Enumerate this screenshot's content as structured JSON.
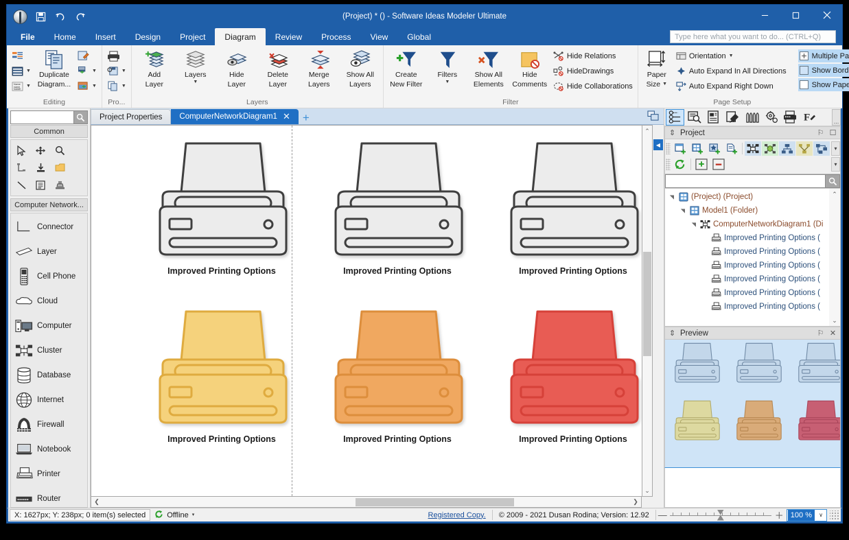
{
  "window": {
    "title": "(Project) * () - Software Ideas Modeler Ultimate",
    "minimize": "—",
    "maximize": "☐",
    "close": "✕"
  },
  "quick_access": {
    "save": "save-icon",
    "undo": "undo-icon",
    "redo": "redo-icon"
  },
  "tell_me": {
    "placeholder": "Type here what you want to do... (CTRL+Q)",
    "value": ""
  },
  "ribbon_tabs": [
    {
      "label": "File",
      "active": false,
      "bold": true
    },
    {
      "label": "Home",
      "active": false
    },
    {
      "label": "Insert",
      "active": false
    },
    {
      "label": "Design",
      "active": false
    },
    {
      "label": "Project",
      "active": false
    },
    {
      "label": "Diagram",
      "active": true
    },
    {
      "label": "Review",
      "active": false
    },
    {
      "label": "Process",
      "active": false
    },
    {
      "label": "View",
      "active": false
    },
    {
      "label": "Global",
      "active": false
    }
  ],
  "ribbon_groups": [
    {
      "label": "Editing",
      "small_left": [
        "rename-diagram",
        "diagram-style",
        "diagram-name"
      ],
      "big": [
        {
          "line1": "Duplicate",
          "line2": "Diagram..."
        }
      ],
      "small_right": [
        "edit-diagram",
        "add-element",
        "diagram-image"
      ]
    },
    {
      "label": "Pro...",
      "small": [
        "print",
        "save-as",
        "copy-diagram"
      ]
    },
    {
      "label": "Layers",
      "buttons": [
        {
          "line1": "Add",
          "line2": "Layer"
        },
        {
          "line1": "Layers",
          "line2": ""
        },
        {
          "line1": "Hide",
          "line2": "Layer"
        },
        {
          "line1": "Delete",
          "line2": "Layer"
        },
        {
          "line1": "Merge",
          "line2": "Layers"
        },
        {
          "line1": "Show All",
          "line2": "Layers"
        }
      ]
    },
    {
      "label": "Filter",
      "buttons": [
        {
          "line1": "Create",
          "line2": "New Filter"
        },
        {
          "line1": "Filters",
          "line2": ""
        },
        {
          "line1": "Show All",
          "line2": "Elements"
        },
        {
          "line1": "Hide",
          "line2": "Comments"
        }
      ],
      "small": [
        "Hide Relations",
        "HideDrawings",
        "Hide Collaborations"
      ]
    },
    {
      "label": "Page Setup",
      "paper": {
        "line1": "Paper",
        "line2": "Size"
      },
      "small": [
        "Orientation",
        "Auto Expand In All Directions",
        "Auto Expand Right Down"
      ],
      "checks": [
        "Multiple Pages",
        "Show Borders",
        "Show Paper"
      ]
    }
  ],
  "toolbox": {
    "search_placeholder": "",
    "search_value": "",
    "common_header": "Common",
    "common_tools": [
      "pointer-icon",
      "move-icon",
      "zoom-icon",
      "connector-tool-icon",
      "insert-icon",
      "note-icon",
      "line-icon",
      "text-icon",
      "stamp-icon"
    ],
    "category_header": "Computer Network...",
    "items": [
      {
        "label": "Connector",
        "icon": "connector-icon"
      },
      {
        "label": "Layer",
        "icon": "layer-icon"
      },
      {
        "label": "Cell Phone",
        "icon": "cell-phone-icon"
      },
      {
        "label": "Cloud",
        "icon": "cloud-icon"
      },
      {
        "label": "Computer",
        "icon": "computer-icon"
      },
      {
        "label": "Cluster",
        "icon": "cluster-icon"
      },
      {
        "label": "Database",
        "icon": "database-icon"
      },
      {
        "label": "Internet",
        "icon": "internet-icon"
      },
      {
        "label": "Firewall",
        "icon": "firewall-icon"
      },
      {
        "label": "Notebook",
        "icon": "notebook-icon"
      },
      {
        "label": "Printer",
        "icon": "printer-icon"
      },
      {
        "label": "Router",
        "icon": "router-icon"
      }
    ]
  },
  "doc_tabs": [
    {
      "label": "Project Properties",
      "active": false,
      "closable": false
    },
    {
      "label": "ComputerNetworkDiagram1",
      "active": true,
      "closable": true
    }
  ],
  "add_tab": "+",
  "canvas": {
    "shapes": [
      {
        "label": "Improved Printing Options",
        "fill": "#ececec",
        "stroke": "#3f3f3f",
        "col": 0,
        "row": 0
      },
      {
        "label": "Improved Printing Options",
        "fill": "#ececec",
        "stroke": "#3f3f3f",
        "col": 1,
        "row": 0
      },
      {
        "label": "Improved Printing Options",
        "fill": "#ececec",
        "stroke": "#3f3f3f",
        "col": 2,
        "row": 0
      },
      {
        "label": "Improved Printing Options",
        "fill": "#f5d27c",
        "stroke": "#dfab3f",
        "col": 0,
        "row": 1
      },
      {
        "label": "Improved Printing Options",
        "fill": "#f0a860",
        "stroke": "#dd8e3c",
        "col": 1,
        "row": 1
      },
      {
        "label": "Improved Printing Options",
        "fill": "#e85c54",
        "stroke": "#d64139",
        "col": 2,
        "row": 1
      }
    ]
  },
  "right_dock": {
    "icons": [
      "project-tree-icon",
      "find-icon",
      "documentation-icon",
      "styles-icon",
      "palette-icon",
      "settings-icon",
      "output-icon",
      "format-icon"
    ],
    "more": "...",
    "project_panel": {
      "title": "Project",
      "pin": "⚐",
      "float": "☐",
      "toolbar_row1": [
        "new-diagram-icon",
        "new-model-icon",
        "new-element-icon",
        "new-document-icon",
        "diagram-type-icon",
        "cluster-type-icon",
        "hierarchy-icon",
        "network-icon",
        "structure-icon"
      ],
      "toolbar_row2": [
        "refresh-icon",
        "expand-all-icon",
        "collapse-all-icon"
      ],
      "search_value": "",
      "tree": [
        {
          "label": "(Project) (Project)",
          "depth": 0,
          "icon": "project-icon",
          "expanded": true
        },
        {
          "label": "Model1 (Folder)",
          "depth": 1,
          "icon": "folder-icon",
          "expanded": true
        },
        {
          "label": "ComputerNetworkDiagram1 (Di",
          "depth": 2,
          "icon": "diagram-icon",
          "expanded": true
        },
        {
          "label": "Improved Printing Options (",
          "depth": 3,
          "icon": "printer-icon"
        },
        {
          "label": "Improved Printing Options (",
          "depth": 3,
          "icon": "printer-icon"
        },
        {
          "label": "Improved Printing Options (",
          "depth": 3,
          "icon": "printer-icon"
        },
        {
          "label": "Improved Printing Options (",
          "depth": 3,
          "icon": "printer-icon"
        },
        {
          "label": "Improved Printing Options (",
          "depth": 3,
          "icon": "printer-icon"
        },
        {
          "label": "Improved Printing Options (",
          "depth": 3,
          "icon": "printer-icon"
        }
      ]
    },
    "preview_panel": {
      "title": "Preview",
      "pin": "⚐",
      "close": "✕",
      "shapes": [
        {
          "fill": "#c3d7ea",
          "stroke": "#6d87a3",
          "col": 0,
          "row": 0
        },
        {
          "fill": "#c3d7ea",
          "stroke": "#6d87a3",
          "col": 1,
          "row": 0
        },
        {
          "fill": "#c3d7ea",
          "stroke": "#6d87a3",
          "col": 2,
          "row": 0
        },
        {
          "fill": "#ddd9a0",
          "stroke": "#b0a96a",
          "col": 0,
          "row": 1
        },
        {
          "fill": "#d9ab79",
          "stroke": "#b5854f",
          "col": 1,
          "row": 1
        },
        {
          "fill": "#c75f73",
          "stroke": "#a84459",
          "col": 2,
          "row": 1
        }
      ]
    }
  },
  "statusbar": {
    "coords": "X: 1627px; Y: 238px; 0 item(s) selected",
    "connection": "Offline",
    "connection_caret": "▾",
    "registered": "Registered Copy.",
    "copyright": "© 2009 - 2021 Dusan Rodina; Version: 12.92",
    "zoom_minus": "—",
    "zoom_plus": "＋",
    "zoom_value": "100 %",
    "zoom_caret": "∨"
  }
}
